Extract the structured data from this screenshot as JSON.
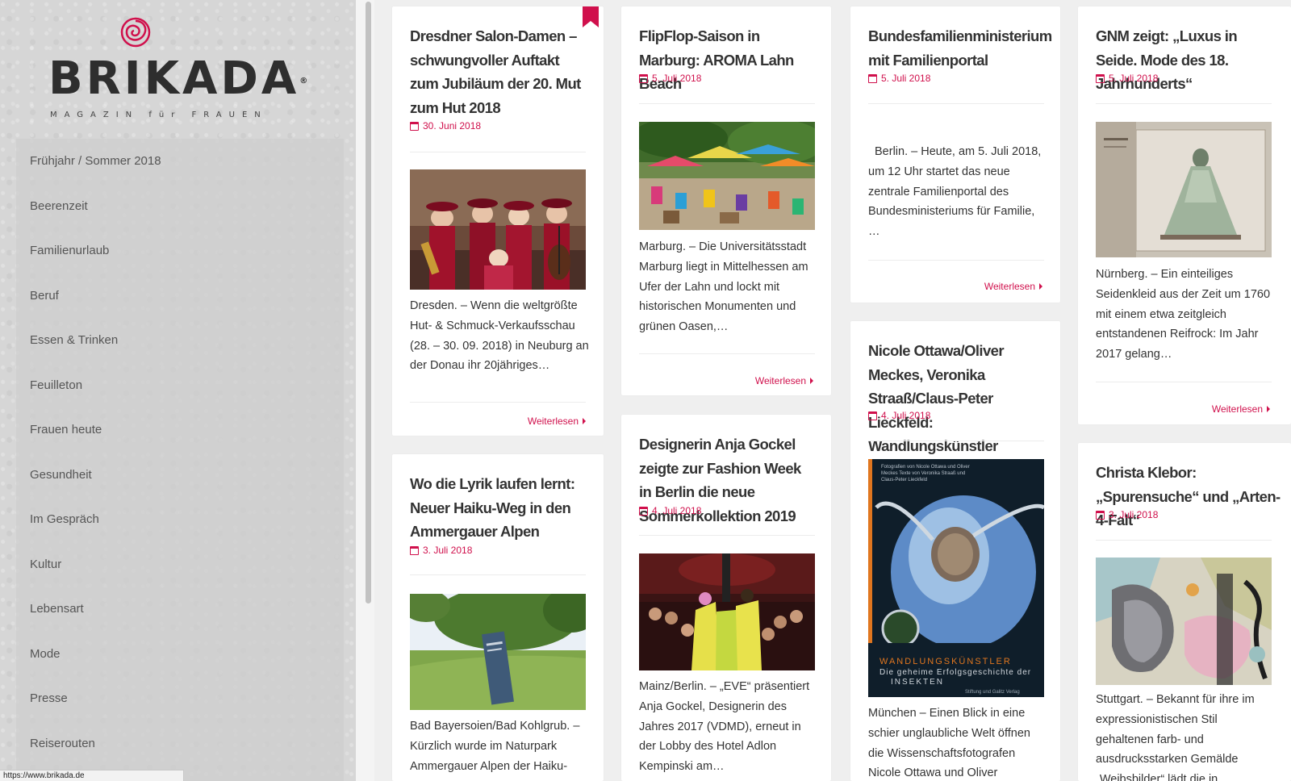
{
  "site": {
    "logo_text": "BRIKADA",
    "logo_tagline": "MAGAZIN für FRAUEN",
    "registered_mark": "®"
  },
  "menu": {
    "items": [
      {
        "label": "Frühjahr / Sommer 2018"
      },
      {
        "label": "Beerenzeit"
      },
      {
        "label": "Familienurlaub"
      },
      {
        "label": "Beruf"
      },
      {
        "label": "Essen & Trinken"
      },
      {
        "label": "Feuilleton"
      },
      {
        "label": "Frauen heute"
      },
      {
        "label": "Gesundheit"
      },
      {
        "label": "Im Gespräch"
      },
      {
        "label": "Kultur"
      },
      {
        "label": "Lebensart"
      },
      {
        "label": "Mode"
      },
      {
        "label": "Presse"
      },
      {
        "label": "Reiserouten"
      }
    ]
  },
  "status_url": "https://www.brikada.de",
  "read_more_label": "Weiterlesen",
  "colors": {
    "accent": "#d0104c",
    "sidebar": "#d6d6d6",
    "page_bg": "#efefef"
  },
  "posts": [
    {
      "title": "Dresdner Salon-Damen – schwungvoller Auftakt zum Jubiläum der 20. Mut zum Hut 2018",
      "date": "30. Juni 2018",
      "excerpt": "Dresden. – Wenn die weltgrößte Hut- & Schmuck-Verkaufsschau (28. – 30. 09. 2018) in Neuburg an der Donau ihr 20jähriges…"
    },
    {
      "title": "Wo die Lyrik laufen lernt: Neuer Haiku-Weg in den Ammergauer Alpen",
      "date": "3. Juli 2018",
      "excerpt": "Bad Bayersoien/Bad Kohlgrub. – Kürzlich wurde im Naturpark Ammergauer Alpen der Haiku-"
    },
    {
      "title": "FlipFlop-Saison in Marburg: AROMA Lahn Beach",
      "date": "5. Juli 2018",
      "excerpt": "Marburg. – Die Universitätsstadt Marburg liegt in Mittelhessen am Ufer der Lahn und lockt mit historischen Monumenten und grünen Oasen,…"
    },
    {
      "title": "Designerin Anja Gockel zeigte zur Fashion Week in Berlin die neue Sommerkollektion 2019",
      "date": "4. Juli 2018",
      "excerpt": "Mainz/Berlin. – „EVE“ präsentiert Anja Gockel, Designerin des Jahres 2017 (VDMD), erneut in der Lobby des Hotel Adlon Kempinski am…"
    },
    {
      "title": "Bundesfamilienministerium mit Familienportal",
      "date": "5. Juli 2018",
      "excerpt": "Berlin. – Heute, am 5. Juli 2018, um 12 Uhr startet das neue zentrale Familienportal des Bundesministeriums für Familie, …"
    },
    {
      "title": "Nicole Ottawa/Oliver Meckes, Veronika Straaß/Claus-Peter Lieckfeld: Wandlungskünstler",
      "date": "4. Juli 2018",
      "excerpt": "München – Einen Blick in eine schier unglaubliche Welt öffnen die Wissenschaftsfotografen Nicole Ottawa und Oliver",
      "cover_text_small": "Fotografien von Nicole Ottawa und Oliver Meckes Texte von Veronika Straaß und Claus-Peter Lieckfeld",
      "cover_title": "WANDLUNGSKÜNSTLER",
      "cover_subtitle": "Die geheime Erfolgsgeschichte der",
      "cover_subtitle2": "INSEKTEN",
      "cover_publisher": "Stiftung und Galitz Verlag"
    },
    {
      "title": "GNM zeigt: „Luxus in Seide. Mode des 18. Jahrhunderts“",
      "date": "5. Juli 2018",
      "excerpt": "Nürnberg. – Ein einteiliges Seidenkleid aus der Zeit um 1760 mit einem etwa zeitgleich entstandenen Reifrock: Im Jahr 2017 gelang…"
    },
    {
      "title": "Christa Klebor: „Spurensuche“ und „Arten-4-Falt“",
      "date": "3. Juli 2018",
      "excerpt": "Stuttgart. – Bekannt für ihre im expressionistischen Stil gehaltenen farb- und ausdrucksstarken Gemälde „Weibsbilder“ lädt die in"
    }
  ]
}
